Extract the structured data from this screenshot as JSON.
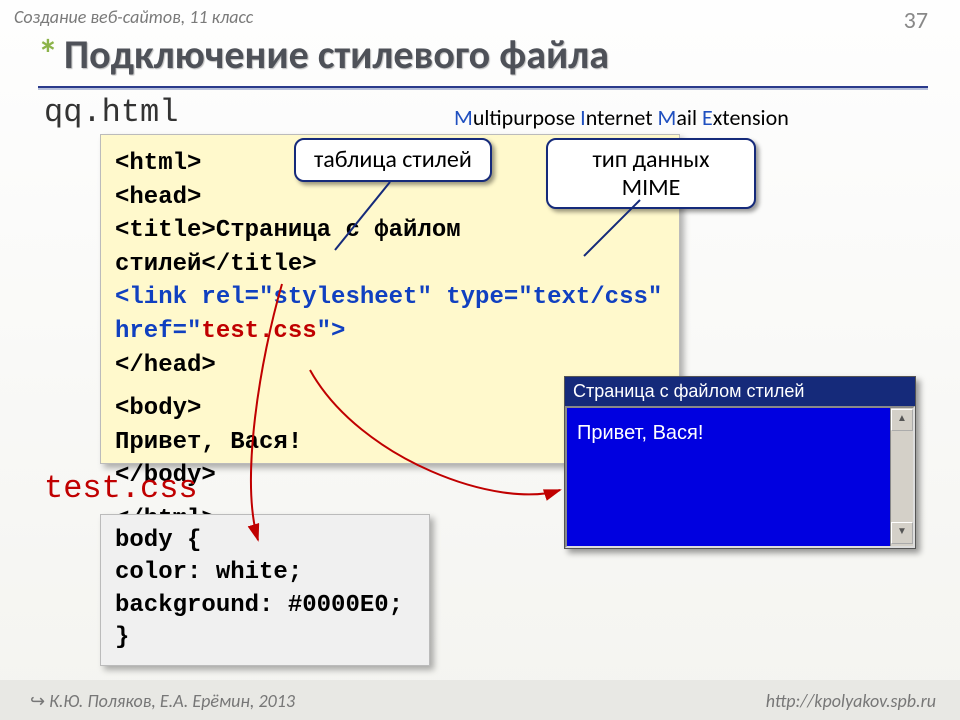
{
  "header": {
    "subject": "Создание веб-сайтов, 11 класс",
    "page": "37"
  },
  "title": {
    "asterisk": "*",
    "text": "Подключение стилевого файла"
  },
  "filename_html": "qq.html",
  "mime": {
    "m1": "M",
    "t1": "ultipurpose ",
    "m2": "I",
    "t2": "nternet ",
    "m3": "M",
    "t3": "ail ",
    "m4": "E",
    "t4": "xtension"
  },
  "code1": {
    "l1": "<html>",
    "l2": "<head>",
    "l3a": "<title>",
    "l3b": "Страница с файлом стилей",
    "l3c": "</title>",
    "l4": "<link rel=\"stylesheet\" type=\"text/css\"",
    "l5a": "      href=\"",
    "l5b": "test.css",
    "l5c": "\">",
    "l6": "</head>",
    "l7": "<body>",
    "l8": "Привет, Вася!",
    "l9": "</body>",
    "l10": "</html>"
  },
  "callouts": {
    "c1": "таблица стилей",
    "c2": "тип данных MIME"
  },
  "browser": {
    "title": "Страница с файлом стилей",
    "content": "Привет, Вася!"
  },
  "filename_css": "test.css",
  "code2": {
    "l1": "body {",
    "l2": "  color: white;",
    "l3": "  background: #0000E0;",
    "l4": "}"
  },
  "footer": {
    "arrow": "↪",
    "left": "К.Ю. Поляков, Е.А. Ерёмин, 2013",
    "right": "http://kpolyakov.spb.ru"
  }
}
